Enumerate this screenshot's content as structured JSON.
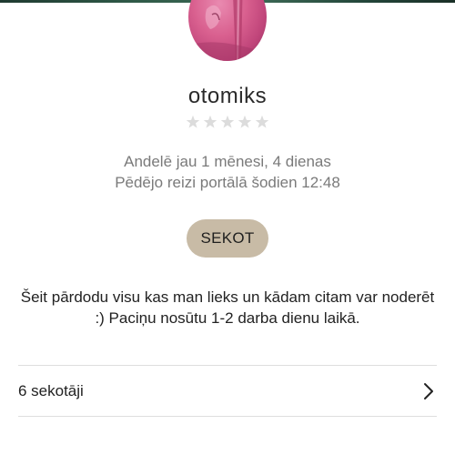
{
  "profile": {
    "username": "otomiks",
    "rating_stars": 5,
    "rating_filled": 0,
    "member_since": "Andelē jau 1 mēnesi, 4 dienas",
    "last_seen": "Pēdējo reizi portālā šodien 12:48",
    "follow_label": "SEKOT",
    "bio": "Šeit pārdodu visu kas man lieks un kādam citam var noderēt :) Paciņu nosūtu 1-2 darba dienu laikā."
  },
  "followers": {
    "label": "6 sekotāji"
  },
  "colors": {
    "follow_button_bg": "#c8bba6",
    "star_empty": "#d9d9d9",
    "muted_text": "#7a7a7a",
    "avatar_pink": "#d9608f"
  },
  "icons": {
    "rating": "star-icon",
    "followers_arrow": "chevron-right-icon"
  }
}
